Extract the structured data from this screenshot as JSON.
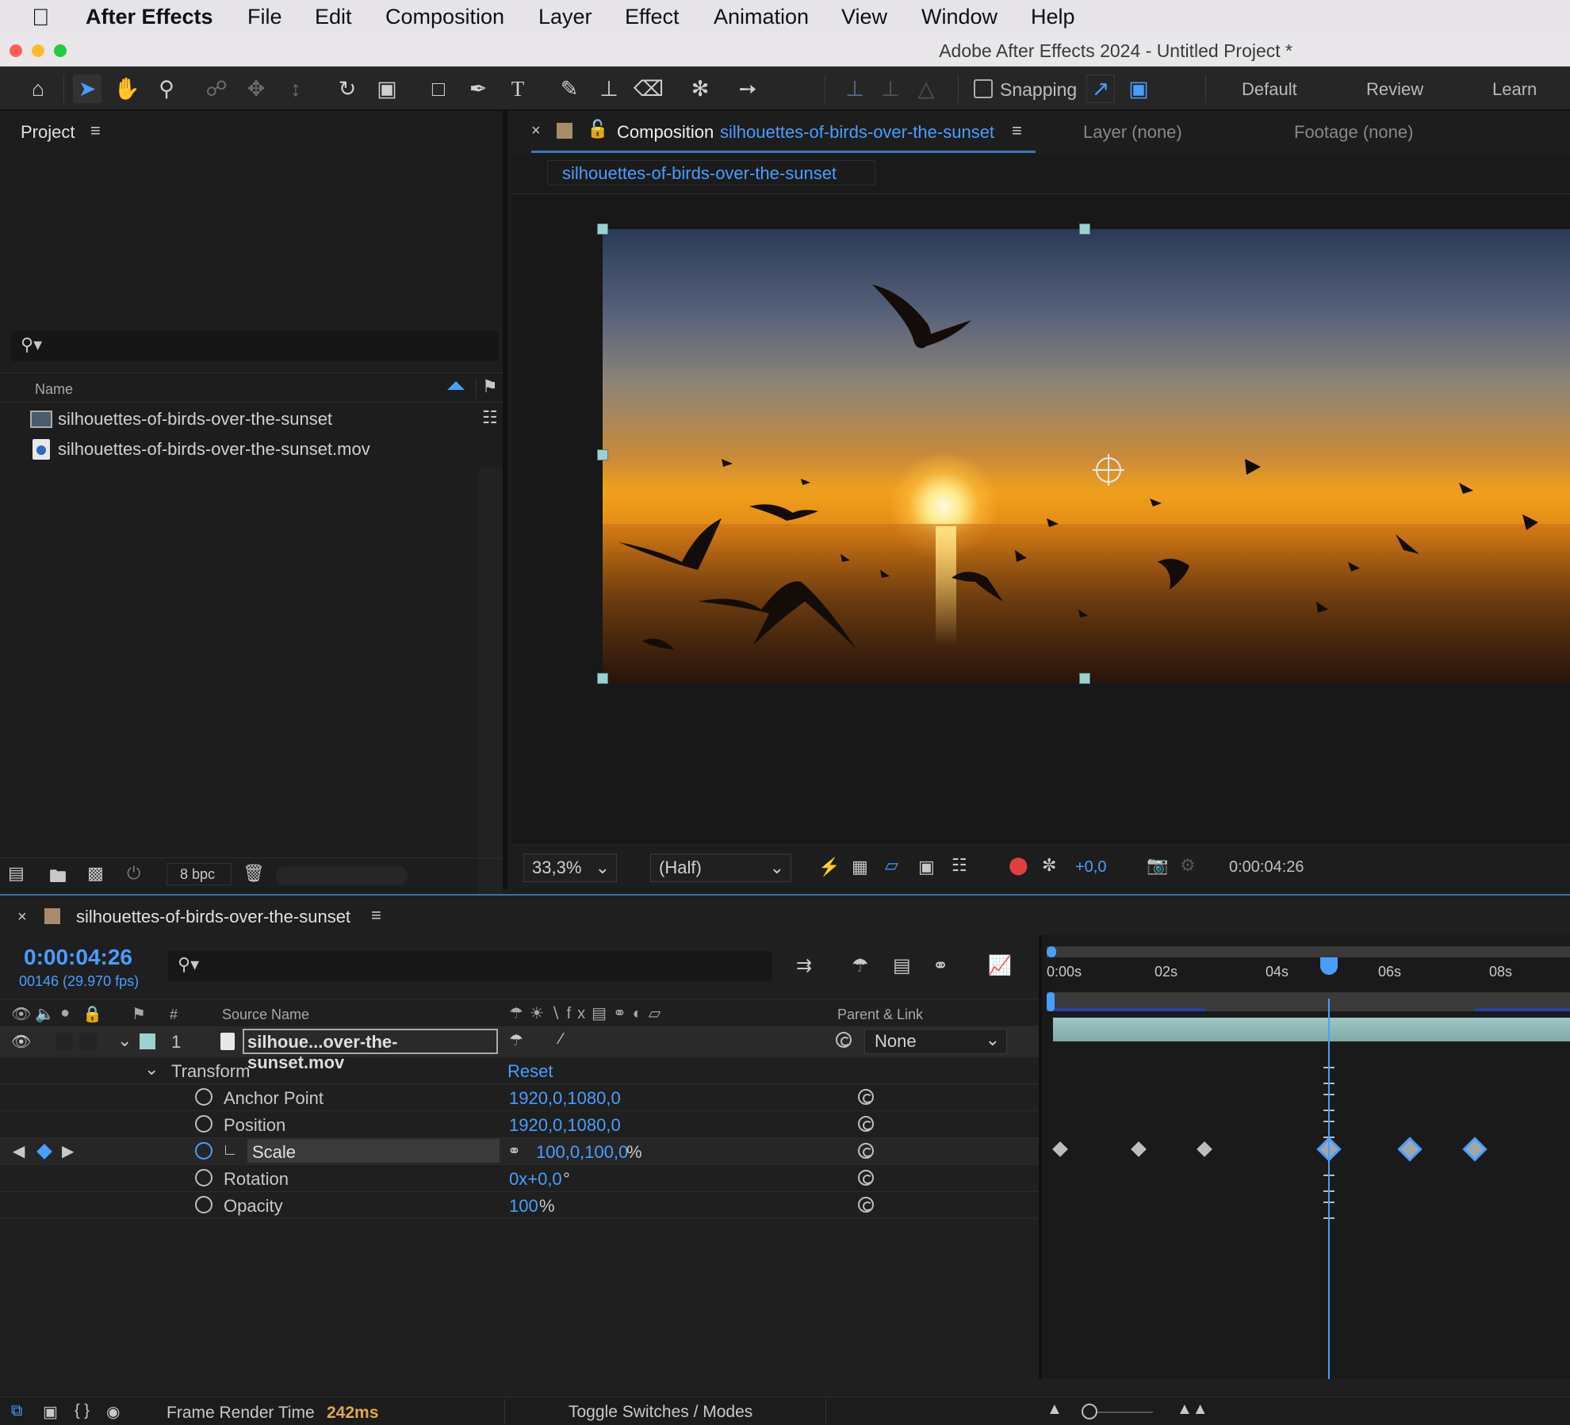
{
  "menubar": {
    "app_name": "After Effects",
    "items": [
      "File",
      "Edit",
      "Composition",
      "Layer",
      "Effect",
      "Animation",
      "View",
      "Window",
      "Help"
    ]
  },
  "window": {
    "title": "Adobe After Effects 2024 - Untitled Project *"
  },
  "toolbar": {
    "snapping_label": "Snapping",
    "workspaces": [
      "Default",
      "Review",
      "Learn"
    ]
  },
  "project": {
    "tab_label": "Project",
    "search_placeholder": "",
    "column_name": "Name",
    "items": [
      {
        "name": "silhouettes-of-birds-over-the-sunset",
        "type": "composition-icon"
      },
      {
        "name": "silhouettes-of-birds-over-the-sunset.mov",
        "type": "footage-icon"
      }
    ],
    "bpc_label": "8 bpc"
  },
  "composition": {
    "tab_prefix": "Composition",
    "tab_name": "silhouettes-of-birds-over-the-sunset",
    "layer_tab": "Layer (none)",
    "footage_tab": "Footage (none)",
    "breadcrumb": "silhouettes-of-birds-over-the-sunset",
    "zoom": "33,3%",
    "resolution": "(Half)",
    "exposure": "+0,0",
    "timecode": "0:00:04:26"
  },
  "timeline": {
    "tab_label": "silhouettes-of-birds-over-the-sunset",
    "current_time": "0:00:04:26",
    "frame_info": "00146 (29.970 fps)",
    "columns": {
      "number": "#",
      "source_name": "Source Name",
      "parent_link": "Parent & Link"
    },
    "ruler_labels": [
      "0:00s",
      "02s",
      "04s",
      "06s",
      "08s"
    ],
    "layer": {
      "number": "1",
      "name": "silhoue...over-the-sunset.mov",
      "parent": "None"
    },
    "transform": {
      "label": "Transform",
      "reset": "Reset",
      "properties": [
        {
          "name": "Anchor Point",
          "value": "1920,0,1080,0",
          "unit": ""
        },
        {
          "name": "Position",
          "value": "1920,0,1080,0",
          "unit": ""
        },
        {
          "name": "Scale",
          "value": "100,0,100,0",
          "unit": "%"
        },
        {
          "name": "Rotation",
          "value": "0x+0,0",
          "unit": "°"
        },
        {
          "name": "Opacity",
          "value": "100",
          "unit": "%"
        }
      ]
    },
    "status": {
      "frame_render_label": "Frame Render Time",
      "frame_render_value": "242ms",
      "toggle_label": "Toggle Switches / Modes"
    }
  },
  "colors": {
    "accent": "#4a9dff",
    "layer_bar": "#8fb8b6",
    "label_teal": "#9ed0cf"
  }
}
